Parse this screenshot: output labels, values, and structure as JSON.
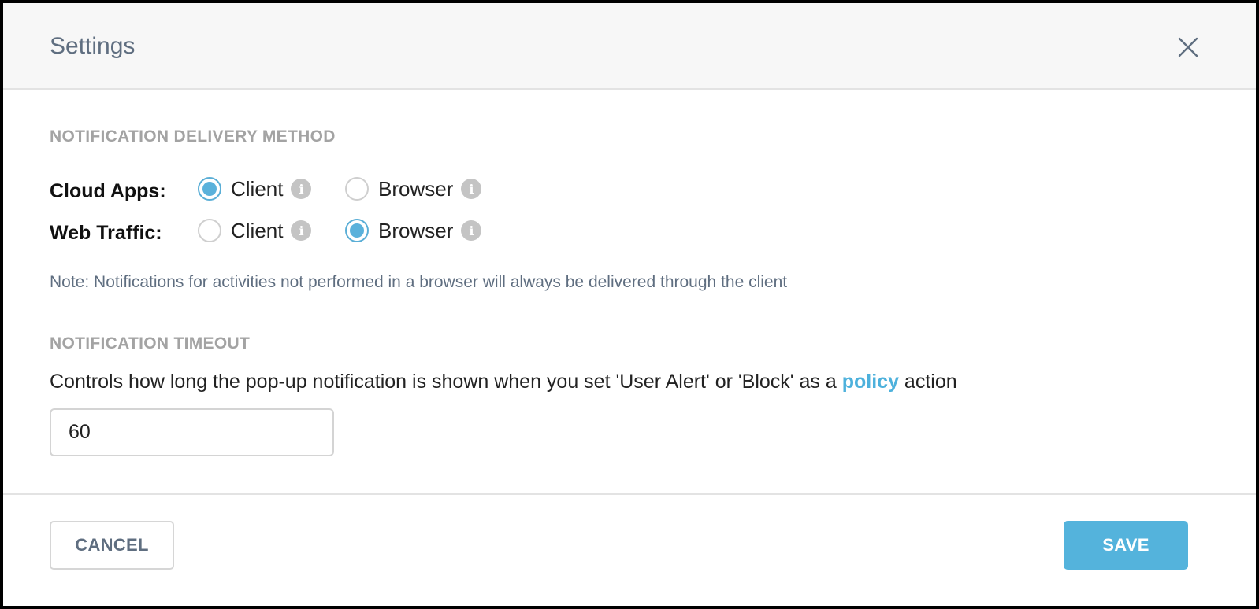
{
  "header": {
    "title": "Settings",
    "close_icon": "close-icon"
  },
  "delivery": {
    "heading": "NOTIFICATION DELIVERY METHOD",
    "rows": [
      {
        "label": "Cloud Apps:",
        "options": [
          {
            "label": "Client",
            "selected": true
          },
          {
            "label": "Browser",
            "selected": false
          }
        ]
      },
      {
        "label": "Web Traffic:",
        "options": [
          {
            "label": "Client",
            "selected": false
          },
          {
            "label": "Browser",
            "selected": true
          }
        ]
      }
    ],
    "info_glyph": "i",
    "note": "Note: Notifications for activities not performed in a browser will always be delivered through the client"
  },
  "timeout": {
    "heading": "NOTIFICATION TIMEOUT",
    "description_before": "Controls how long the pop-up notification is shown when you set 'User Alert' or 'Block' as a ",
    "link_text": "policy",
    "description_after": " action",
    "value": "60"
  },
  "footer": {
    "cancel_label": "CANCEL",
    "save_label": "SAVE"
  },
  "colors": {
    "accent": "#54b3dc",
    "radio_selected": "#5ab1db",
    "muted_text": "#5f6e80"
  }
}
